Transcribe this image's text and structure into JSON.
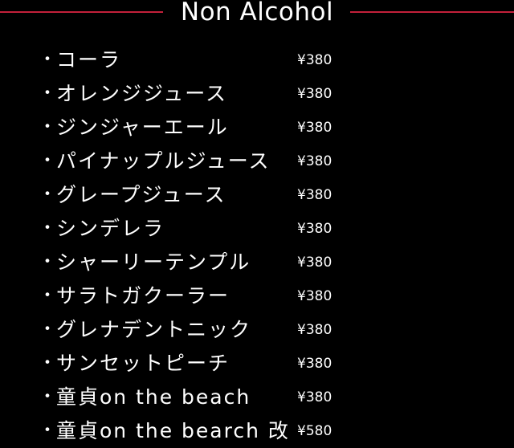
{
  "header": {
    "title": "Non Alcohol",
    "accent_color": "#c2203a"
  },
  "menu": {
    "bullet": "・",
    "items": [
      {
        "name": "コーラ",
        "price": "¥380"
      },
      {
        "name": "オレンジジュース",
        "price": "¥380"
      },
      {
        "name": "ジンジャーエール",
        "price": "¥380"
      },
      {
        "name": "パイナップルジュース",
        "price": "¥380"
      },
      {
        "name": "グレープジュース",
        "price": "¥380"
      },
      {
        "name": "シンデレラ",
        "price": "¥380"
      },
      {
        "name": "シャーリーテンプル",
        "price": "¥380"
      },
      {
        "name": "サラトガクーラー",
        "price": "¥380"
      },
      {
        "name": "グレナデントニック",
        "price": "¥380"
      },
      {
        "name": "サンセットピーチ",
        "price": "¥380"
      },
      {
        "name": "童貞on the beach",
        "price": "¥380"
      },
      {
        "name": "童貞on the bearch 改",
        "price": "¥580"
      }
    ]
  }
}
